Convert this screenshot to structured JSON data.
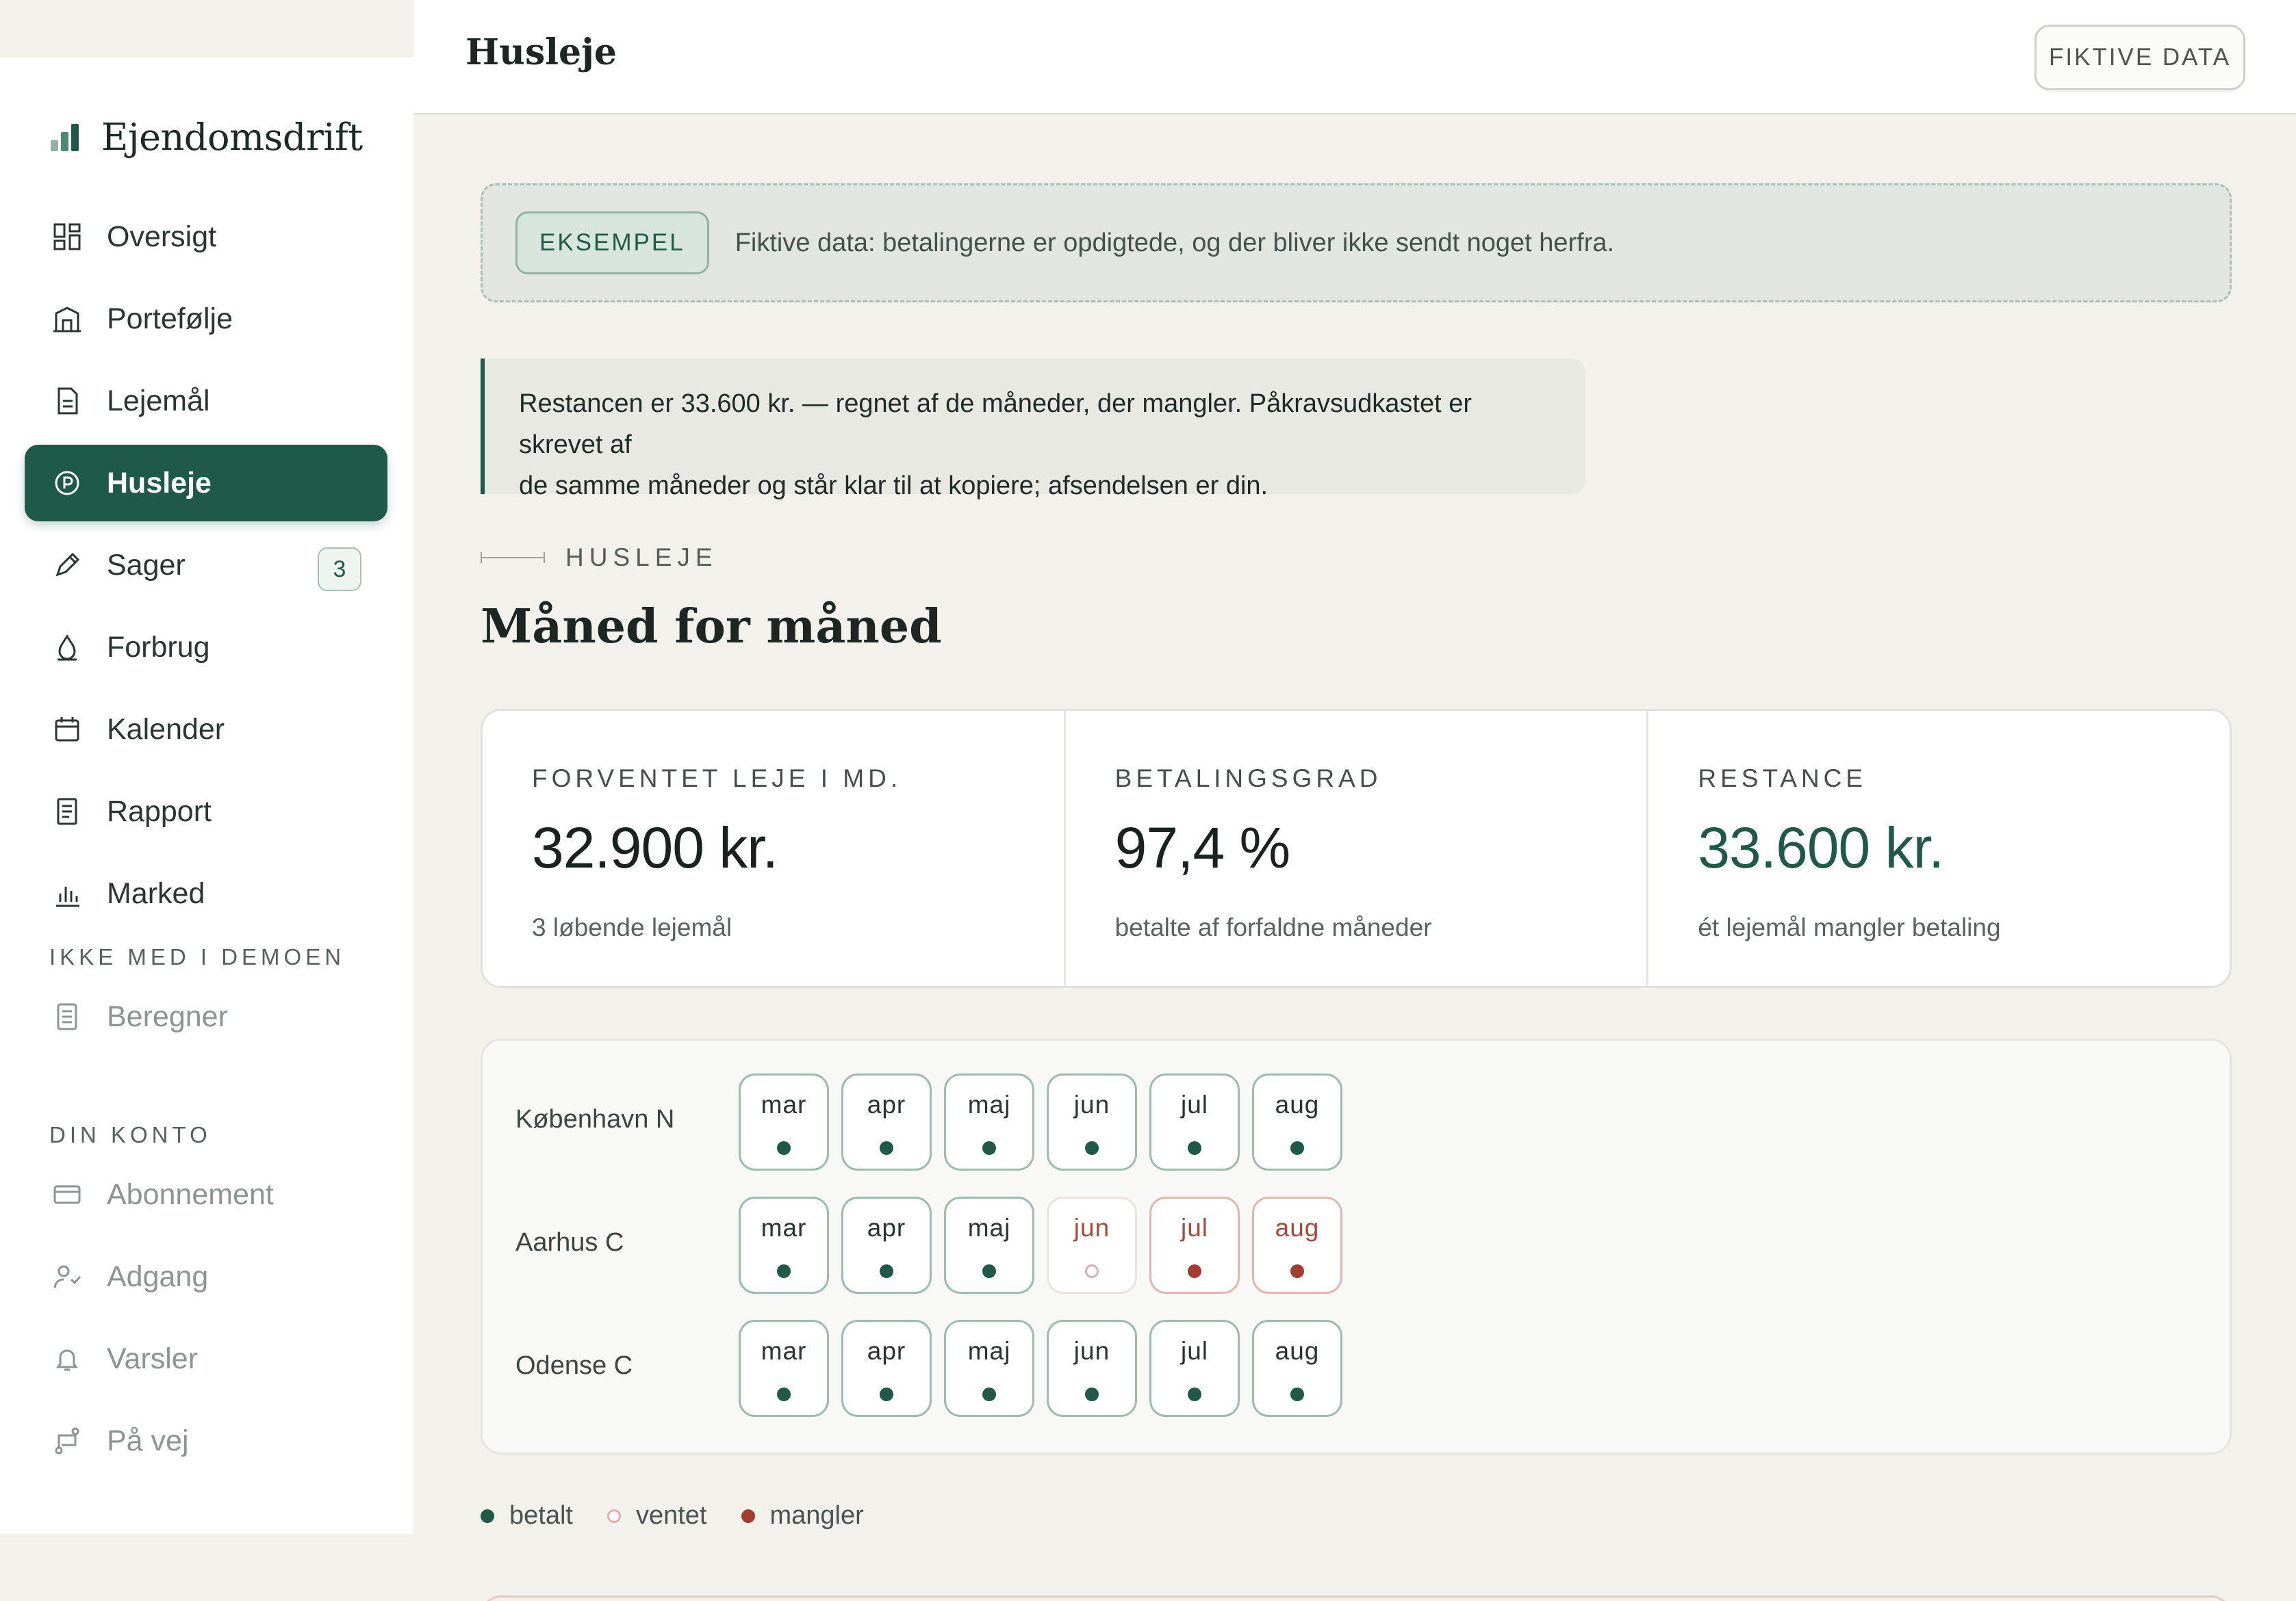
{
  "app": {
    "brand": "Ejendomsdrift"
  },
  "colors": {
    "accent": "#1f5a48",
    "missing": "#a23d2f",
    "waiting": "#e3aeaa",
    "background": "#f2f1ec"
  },
  "sidebar": {
    "items": [
      {
        "label": "Oversigt",
        "icon": "dashboard-icon"
      },
      {
        "label": "Portefølje",
        "icon": "building-icon"
      },
      {
        "label": "Lejemål",
        "icon": "document-icon"
      },
      {
        "label": "Husleje",
        "icon": "rent-coin-icon",
        "active": true
      },
      {
        "label": "Sager",
        "icon": "pencil-icon",
        "badge": "3"
      },
      {
        "label": "Forbrug",
        "icon": "drop-icon"
      },
      {
        "label": "Kalender",
        "icon": "calendar-icon"
      },
      {
        "label": "Rapport",
        "icon": "report-icon"
      },
      {
        "label": "Marked",
        "icon": "bar-chart-icon"
      }
    ],
    "section_demo": "IKKE MED I DEMOEN",
    "demo_items": [
      {
        "label": "Beregner",
        "icon": "calculator-icon"
      }
    ],
    "section_account": "DIN KONTO",
    "account_items": [
      {
        "label": "Abonnement",
        "icon": "credit-card-icon"
      },
      {
        "label": "Adgang",
        "icon": "user-access-icon"
      },
      {
        "label": "Varsler",
        "icon": "bell-icon"
      },
      {
        "label": "På vej",
        "icon": "route-icon"
      }
    ]
  },
  "header": {
    "title": "Husleje",
    "fiktive_button": "FIKTIVE DATA"
  },
  "banner": {
    "tag": "EKSEMPEL",
    "text": "Fiktive data: betalingerne er opdigtede, og der bliver ikke sendt noget herfra."
  },
  "notice": {
    "line1": "Restancen er 33.600 kr. — regnet af de måneder, der mangler. Påkravsudkastet er skrevet af",
    "line2": "de samme måneder og står klar til at kopiere; afsendelsen er din."
  },
  "section": {
    "eyebrow": "HUSLEJE",
    "title": "Måned for måned"
  },
  "kpis": [
    {
      "label": "FORVENTET LEJE I MD.",
      "value": "32.900 kr.",
      "sub": "3 løbende lejemål"
    },
    {
      "label": "BETALINGSGRAD",
      "value": "97,4 %",
      "sub": "betalte af forfaldne måneder"
    },
    {
      "label": "RESTANCE",
      "value": "33.600 kr.",
      "sub": "ét lejemål mangler betaling"
    }
  ],
  "payment_grid": {
    "months": [
      "mar",
      "apr",
      "maj",
      "jun",
      "jul",
      "aug"
    ],
    "rows": [
      {
        "label": "København N",
        "status": [
          "paid",
          "paid",
          "paid",
          "paid",
          "paid",
          "paid"
        ]
      },
      {
        "label": "Aarhus C",
        "status": [
          "paid",
          "paid",
          "paid",
          "waiting",
          "missing",
          "missing"
        ]
      },
      {
        "label": "Odense C",
        "status": [
          "paid",
          "paid",
          "paid",
          "paid",
          "paid",
          "paid"
        ]
      }
    ]
  },
  "legend": {
    "paid": "betalt",
    "waiting": "ventet",
    "missing": "mangler"
  }
}
